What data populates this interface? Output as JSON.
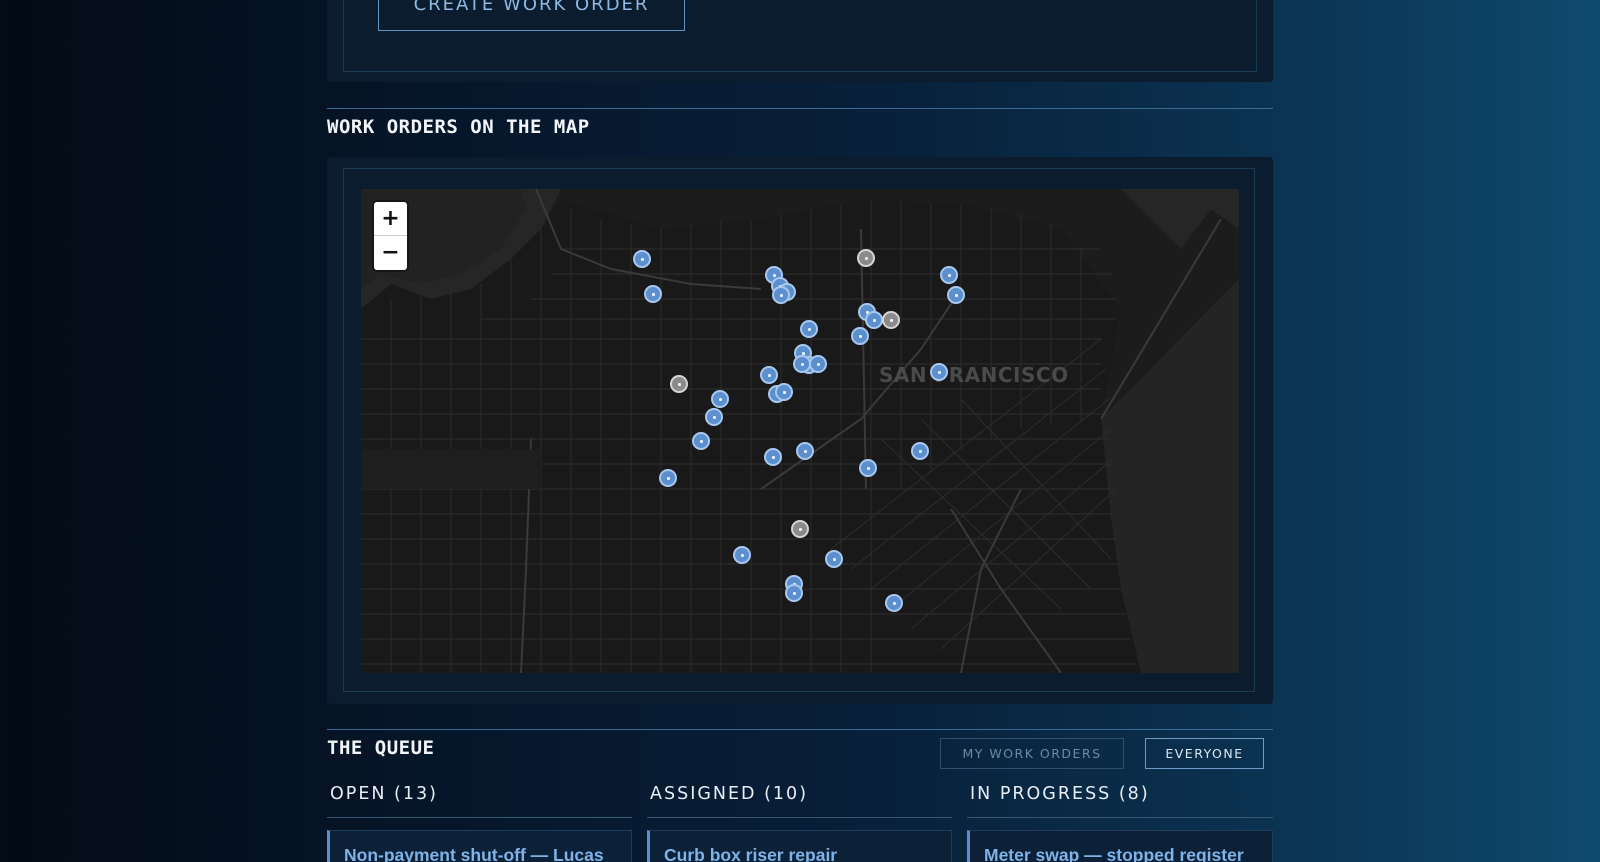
{
  "actions": {
    "create_work_order_label": "CREATE WORK ORDER"
  },
  "map_section": {
    "title": "WORK ORDERS ON THE MAP",
    "city_label": "SAN FRANCISCO",
    "zoom_in_label": "+",
    "zoom_out_label": "−",
    "marker_colors": {
      "blue": "#5b8fcd",
      "gray": "#8a8a8a"
    }
  },
  "queue": {
    "title": "THE QUEUE",
    "filters": {
      "mine_label": "MY WORK ORDERS",
      "everyone_label": "EVERYONE",
      "selected": "EVERYONE"
    },
    "columns": [
      {
        "heading": "OPEN (13)",
        "first_card": "Non-payment shut-off — Lucas"
      },
      {
        "heading": "ASSIGNED (10)",
        "first_card": "Curb box riser repair"
      },
      {
        "heading": "IN PROGRESS (8)",
        "first_card": "Meter swap — stopped register"
      }
    ]
  }
}
